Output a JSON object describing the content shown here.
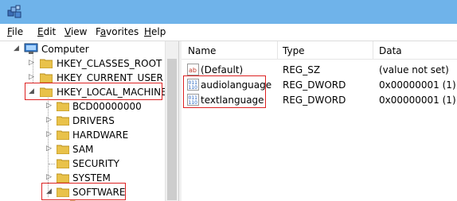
{
  "menu": [
    "File",
    "Edit",
    "View",
    "Favorites",
    "Help"
  ],
  "menu_accel": [
    "F",
    "E",
    "V",
    "a",
    "H"
  ],
  "tree": {
    "root": "Computer",
    "items": [
      {
        "label": "HKEY_CLASSES_ROOT",
        "arrow": "▷"
      },
      {
        "label": "HKEY_CURRENT_USER",
        "arrow": "▷"
      },
      {
        "label": "HKEY_LOCAL_MACHINE",
        "arrow": "◢"
      },
      {
        "label": "BCD00000000",
        "arrow": "▷"
      },
      {
        "label": "DRIVERS",
        "arrow": "▷"
      },
      {
        "label": "HARDWARE",
        "arrow": "▷"
      },
      {
        "label": "SAM",
        "arrow": "▷"
      },
      {
        "label": "SECURITY",
        "arrow": ""
      },
      {
        "label": "SYSTEM",
        "arrow": "▷"
      },
      {
        "label": "SOFTWARE",
        "arrow": "◢"
      }
    ]
  },
  "list": {
    "columns": [
      "Name",
      "Type",
      "Data"
    ],
    "rows": [
      {
        "name": "(Default)",
        "type": "REG_SZ",
        "data": "(value not set)",
        "icon": "string-value-icon"
      },
      {
        "name": "audiolanguage",
        "type": "REG_DWORD",
        "data": "0x00000001 (1)",
        "icon": "binary-value-icon"
      },
      {
        "name": "textlanguage",
        "type": "REG_DWORD",
        "data": "0x00000001 (1)",
        "icon": "binary-value-icon"
      }
    ]
  },
  "colors": {
    "titlebar": "#6fb3ea",
    "highlight": "#dd2222",
    "folder": "#e9c24a"
  }
}
